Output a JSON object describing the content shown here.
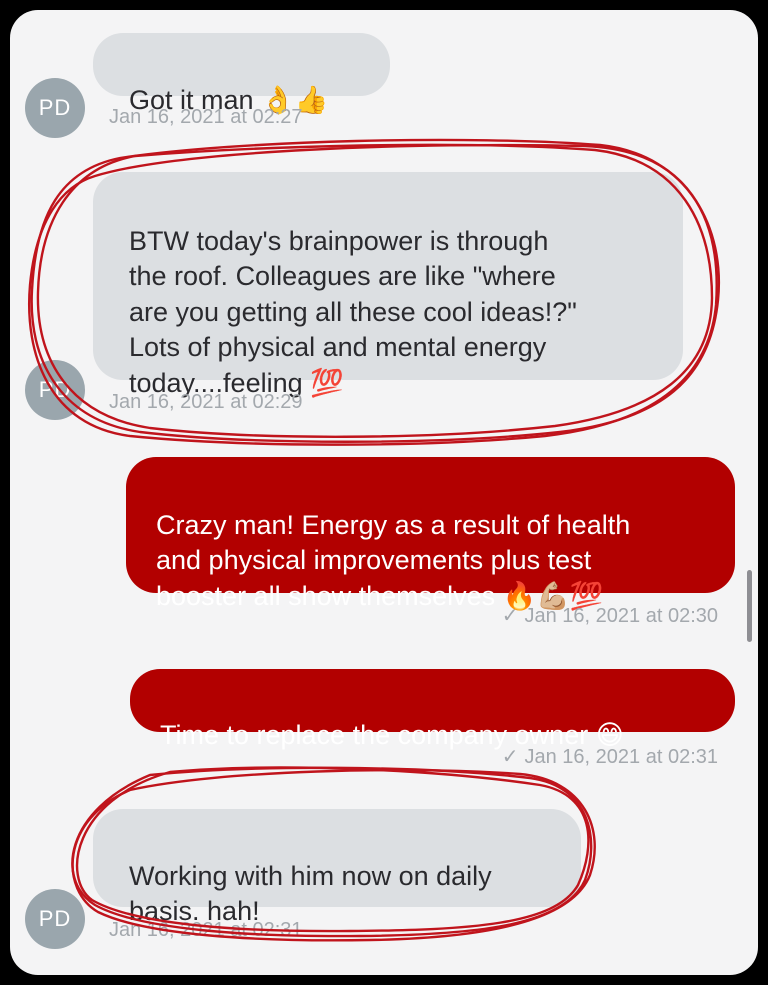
{
  "conversation": {
    "contact_initials": "PD",
    "messages": [
      {
        "direction": "incoming",
        "text": "Got it man 👌👍",
        "timestamp": "Jan 16, 2021 at 02:27"
      },
      {
        "direction": "incoming",
        "text": "BTW today's brainpower is through\nthe roof.  Colleagues are like \"where\nare you getting all these cool ideas!?\"\nLots of physical and mental energy\ntoday....feeling 💯",
        "timestamp": "Jan 16, 2021 at 02:29"
      },
      {
        "direction": "outgoing",
        "text": "Crazy man! Energy as a result of health\nand physical improvements plus test\nbooster all show themselves 🔥💪🏼💯",
        "timestamp": "Jan 16, 2021 at 02:30",
        "read_mark": "✓"
      },
      {
        "direction": "outgoing",
        "text": "Time to replace the company owner 😄",
        "timestamp": "Jan 16, 2021 at 02:31",
        "read_mark": "✓"
      },
      {
        "direction": "incoming",
        "text": "Working with him now on daily\nbasis.  hah!",
        "timestamp": "Jan 16, 2021 at 02:31"
      }
    ]
  },
  "colors": {
    "incoming_bubble": "#dcdfe2",
    "outgoing_bubble": "#b20000",
    "avatar": "#9aa6ad",
    "annotation_ink": "#c0141c"
  }
}
